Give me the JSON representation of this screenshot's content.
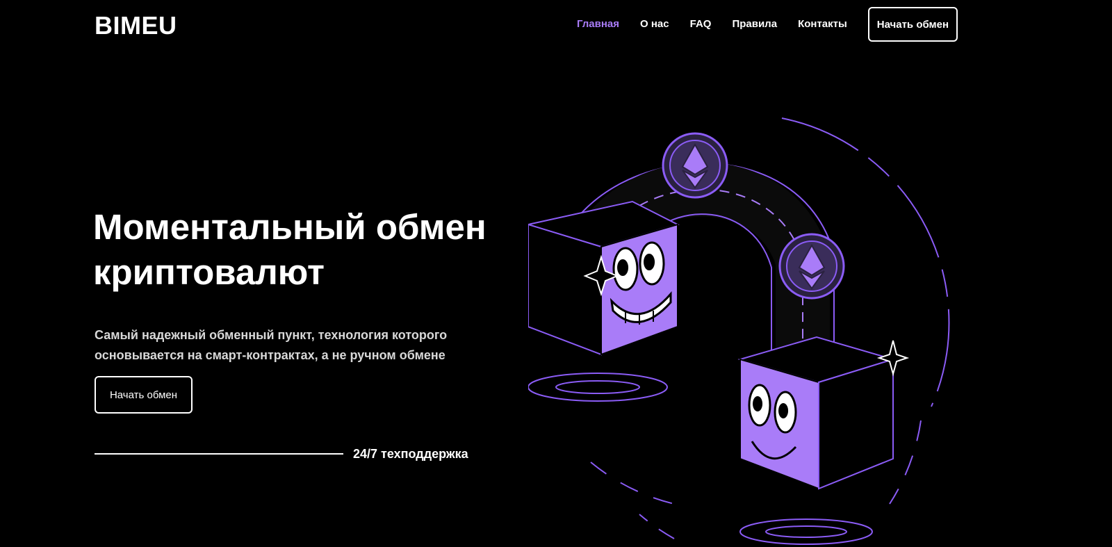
{
  "header": {
    "logo": "BIMEU",
    "nav": [
      {
        "label": "Главная",
        "active": true
      },
      {
        "label": "О нас",
        "active": false
      },
      {
        "label": "FAQ",
        "active": false
      },
      {
        "label": "Правила",
        "active": false
      },
      {
        "label": "Контакты",
        "active": false
      }
    ],
    "cta_label": "Начать обмен"
  },
  "hero": {
    "title_line1": "Моментальный обмен",
    "title_line2": "криптовалют",
    "subtitle_line1": "Самый надежный обменный пункт, технология которого",
    "subtitle_line2": "основывается на смарт-контрактах, а не ручном обмене",
    "button_label": "Начать обмен",
    "support_text": "24/7 техподдержка"
  },
  "illustration": {
    "icons": [
      "ethereum-coin-icon",
      "ethereum-coin-icon",
      "smiling-cube-icon",
      "smiling-cube-icon",
      "sparkle-icon"
    ]
  },
  "colors": {
    "background": "#000000",
    "accent": "#a97cf8",
    "text": "#ffffff"
  }
}
